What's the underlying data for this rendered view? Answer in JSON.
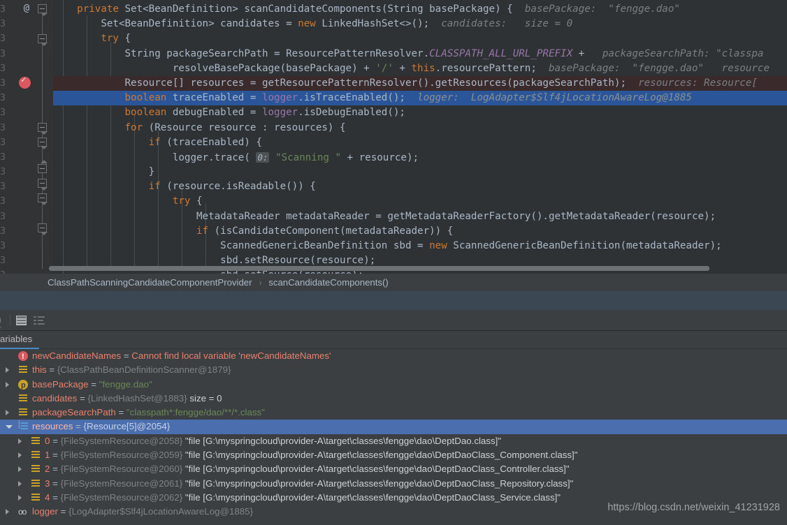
{
  "editor": {
    "gutter": {
      "annotation_icon": "at-icon",
      "breakpoint_icon": "breakpoint-verified-icon"
    },
    "lines": [
      {
        "indent": 0,
        "tokens": [
          {
            "t": "    ",
            "c": "txt"
          },
          {
            "t": "private",
            "c": "kw"
          },
          {
            "t": " Set<BeanDefinition> ",
            "c": "txt"
          },
          {
            "t": "scanCandidateComponents",
            "c": "mth"
          },
          {
            "t": "(String basePackage) {",
            "c": "txt"
          }
        ],
        "hint": "basePackage:  \"fengge.dao\""
      },
      {
        "indent": 0,
        "tokens": [
          {
            "t": "        Set<BeanDefinition> candidates = ",
            "c": "txt"
          },
          {
            "t": "new",
            "c": "kw"
          },
          {
            "t": " LinkedHashSet<>();",
            "c": "txt"
          }
        ],
        "hint": "candidates:   size = 0"
      },
      {
        "indent": 0,
        "tokens": [
          {
            "t": "        ",
            "c": "txt"
          },
          {
            "t": "try",
            "c": "kw"
          },
          {
            "t": " {",
            "c": "txt"
          }
        ],
        "hint": ""
      },
      {
        "indent": 0,
        "tokens": [
          {
            "t": "            String packageSearchPath = ResourcePatternResolver.",
            "c": "txt"
          },
          {
            "t": "CLASSPATH_ALL_URL_PREFIX",
            "c": "sfld"
          },
          {
            "t": " + ",
            "c": "txt"
          }
        ],
        "hint": "packageSearchPath: \"classpa"
      },
      {
        "indent": 0,
        "tokens": [
          {
            "t": "                    resolveBasePackage(basePackage) + ",
            "c": "txt"
          },
          {
            "t": "'/'",
            "c": "str"
          },
          {
            "t": " + ",
            "c": "txt"
          },
          {
            "t": "this",
            "c": "kw"
          },
          {
            "t": ".resourcePattern;",
            "c": "txt"
          }
        ],
        "hint": "basePackage:  \"fengge.dao\"   resource"
      },
      {
        "indent": 0,
        "highlight": "breakpoint",
        "tokens": [
          {
            "t": "            Resource[] resources = getResourcePatternResolver().getResources(packageSearchPath);",
            "c": "txt"
          }
        ],
        "hint": "resources: Resource["
      },
      {
        "indent": 0,
        "highlight": "current",
        "tokens": [
          {
            "t": "            ",
            "c": "txt"
          },
          {
            "t": "boolean",
            "c": "kw"
          },
          {
            "t": " traceEnabled = ",
            "c": "txt"
          },
          {
            "t": "logger",
            "c": "fld"
          },
          {
            "t": ".isTraceEnabled();",
            "c": "txt"
          }
        ],
        "hint": "logger:  LogAdapter$Slf4jLocationAwareLog@1885"
      },
      {
        "indent": 0,
        "tokens": [
          {
            "t": "            ",
            "c": "txt"
          },
          {
            "t": "boolean",
            "c": "kw"
          },
          {
            "t": " debugEnabled = ",
            "c": "txt"
          },
          {
            "t": "logger",
            "c": "fld"
          },
          {
            "t": ".isDebugEnabled();",
            "c": "txt"
          }
        ],
        "hint": ""
      },
      {
        "indent": 0,
        "tokens": [
          {
            "t": "            ",
            "c": "txt"
          },
          {
            "t": "for",
            "c": "kw"
          },
          {
            "t": " (Resource resource : resources) {",
            "c": "txt"
          }
        ],
        "hint": ""
      },
      {
        "indent": 0,
        "tokens": [
          {
            "t": "                ",
            "c": "txt"
          },
          {
            "t": "if",
            "c": "kw"
          },
          {
            "t": " (traceEnabled) {",
            "c": "txt"
          }
        ],
        "hint": ""
      },
      {
        "indent": 0,
        "tokens": [
          {
            "t": "                    logger.trace( ",
            "c": "txt"
          },
          {
            "t": "0:",
            "c": "pbadge"
          },
          {
            "t": " ",
            "c": "txt"
          },
          {
            "t": "\"Scanning \"",
            "c": "str"
          },
          {
            "t": " + resource);",
            "c": "txt"
          }
        ],
        "hint": ""
      },
      {
        "indent": 0,
        "tokens": [
          {
            "t": "                }",
            "c": "txt"
          }
        ],
        "hint": ""
      },
      {
        "indent": 0,
        "tokens": [
          {
            "t": "                ",
            "c": "txt"
          },
          {
            "t": "if",
            "c": "kw"
          },
          {
            "t": " (resource.isReadable()) {",
            "c": "txt"
          }
        ],
        "hint": ""
      },
      {
        "indent": 0,
        "tokens": [
          {
            "t": "                    ",
            "c": "txt"
          },
          {
            "t": "try",
            "c": "kw"
          },
          {
            "t": " {",
            "c": "txt"
          }
        ],
        "hint": ""
      },
      {
        "indent": 0,
        "tokens": [
          {
            "t": "                        MetadataReader metadataReader = getMetadataReaderFactory().getMetadataReader(resource);",
            "c": "txt"
          }
        ],
        "hint": ""
      },
      {
        "indent": 0,
        "tokens": [
          {
            "t": "                        ",
            "c": "txt"
          },
          {
            "t": "if",
            "c": "kw"
          },
          {
            "t": " (isCandidateComponent(metadataReader)) {",
            "c": "txt"
          }
        ],
        "hint": ""
      },
      {
        "indent": 0,
        "tokens": [
          {
            "t": "                            ScannedGenericBeanDefinition sbd = ",
            "c": "txt"
          },
          {
            "t": "new",
            "c": "kw"
          },
          {
            "t": " ScannedGenericBeanDefinition(metadataReader);",
            "c": "txt"
          }
        ],
        "hint": ""
      },
      {
        "indent": 0,
        "tokens": [
          {
            "t": "                            sbd.setResource(resource);",
            "c": "txt"
          }
        ],
        "hint": ""
      },
      {
        "indent": 0,
        "tokens": [
          {
            "t": "                            sbd.setSource(resource);",
            "c": "txt"
          }
        ],
        "hint": ""
      }
    ]
  },
  "breadcrumb": {
    "class": "ClassPathScanningCandidateComponentProvider",
    "separator": "›",
    "method": "scanCandidateComponents()"
  },
  "debug_toolbar": {
    "icons": [
      "table-view-icon",
      "list-view-icon"
    ]
  },
  "variables_panel": {
    "tab_label": "ariables",
    "rows": [
      {
        "depth": 0,
        "arrow": "none",
        "icon": "error-icon",
        "name": "newCandidateNames",
        "eq": " = ",
        "value": "Cannot find local variable 'newCandidateNames'",
        "value_class": "verr"
      },
      {
        "depth": 0,
        "arrow": "closed",
        "icon": "object-icon",
        "name": "this",
        "eq": " = ",
        "value": "{ClassPathBeanDefinitionScanner@1879}",
        "value_class": "vref"
      },
      {
        "depth": 0,
        "arrow": "closed",
        "icon": "param-icon",
        "name": "basePackage",
        "eq": " = ",
        "value": "\"fengge.dao\"",
        "value_class": "vstr"
      },
      {
        "depth": 0,
        "arrow": "none",
        "icon": "object-icon",
        "name": "candidates",
        "eq": " = ",
        "value": "{LinkedHashSet@1883}",
        "value_class": "vref",
        "extra": "size = 0"
      },
      {
        "depth": 0,
        "arrow": "closed",
        "icon": "object-icon",
        "name": "packageSearchPath",
        "eq": " = ",
        "value": "\"classpath*:fengge/dao/**/*.class\"",
        "value_class": "vstr"
      },
      {
        "depth": 0,
        "arrow": "open",
        "icon": "array-icon",
        "selected": true,
        "name": "resources",
        "eq": " = ",
        "value": "{Resource[5]@2054}",
        "value_class": "vref"
      },
      {
        "depth": 1,
        "arrow": "closed",
        "icon": "object-icon",
        "name": "0",
        "eq": " = ",
        "value": "{FileSystemResource@2058}",
        "value_class": "vref",
        "path": "\"file [G:\\myspringcloud\\provider-A\\target\\classes\\fengge\\dao\\DeptDao.class]\""
      },
      {
        "depth": 1,
        "arrow": "closed",
        "icon": "object-icon",
        "name": "1",
        "eq": " = ",
        "value": "{FileSystemResource@2059}",
        "value_class": "vref",
        "path": "\"file [G:\\myspringcloud\\provider-A\\target\\classes\\fengge\\dao\\DeptDaoClass_Component.class]\""
      },
      {
        "depth": 1,
        "arrow": "closed",
        "icon": "object-icon",
        "name": "2",
        "eq": " = ",
        "value": "{FileSystemResource@2060}",
        "value_class": "vref",
        "path": "\"file [G:\\myspringcloud\\provider-A\\target\\classes\\fengge\\dao\\DeptDaoClass_Controller.class]\""
      },
      {
        "depth": 1,
        "arrow": "closed",
        "icon": "object-icon",
        "name": "3",
        "eq": " = ",
        "value": "{FileSystemResource@2061}",
        "value_class": "vref",
        "path": "\"file [G:\\myspringcloud\\provider-A\\target\\classes\\fengge\\dao\\DeptDaoClass_Repository.class]\""
      },
      {
        "depth": 1,
        "arrow": "closed",
        "icon": "object-icon",
        "name": "4",
        "eq": " = ",
        "value": "{FileSystemResource@2062}",
        "value_class": "vref",
        "path": "\"file [G:\\myspringcloud\\provider-A\\target\\classes\\fengge\\dao\\DeptDaoClass_Service.class]\""
      },
      {
        "depth": 0,
        "arrow": "closed",
        "icon": "field-icon",
        "name": "logger",
        "eq": " = ",
        "value": "{LogAdapter$Slf4jLocationAwareLog@1885}",
        "value_class": "vref"
      }
    ]
  },
  "watermark": "https://blog.csdn.net/weixin_41231928",
  "colors": {
    "editor_bg": "#2f3234",
    "panel_bg": "#3c3f41",
    "current_line": "#2a5699",
    "breakpoint_line": "#3b2a2c",
    "selection": "#4b6eaf",
    "blue_band": "#3c4754",
    "accent": "#4a88c7",
    "keyword": "#cc7832",
    "string": "#6a8759",
    "field": "#9876aa",
    "text": "#a9b7c6",
    "hint": "#7a7f82"
  }
}
